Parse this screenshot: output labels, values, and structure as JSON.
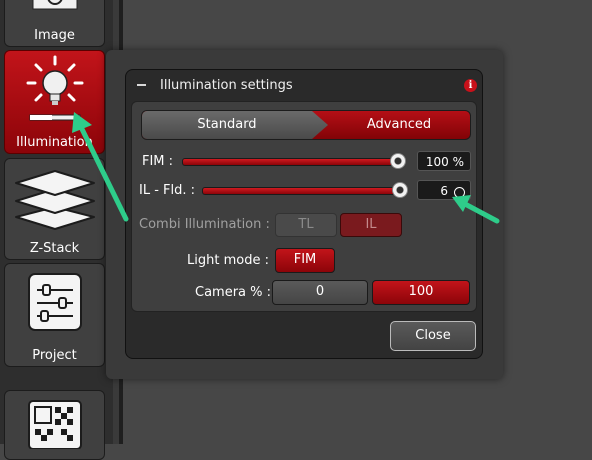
{
  "sidebar": {
    "items": [
      {
        "label": "Image",
        "icon": "image-icon",
        "active": false
      },
      {
        "label": "Illumination",
        "icon": "lamp-icon",
        "active": true
      },
      {
        "label": "Z-Stack",
        "icon": "layers-icon",
        "active": false
      },
      {
        "label": "Project",
        "icon": "sliders-icon",
        "active": false
      },
      {
        "label": "",
        "icon": "grid-icon",
        "active": false
      }
    ]
  },
  "dialog": {
    "title": "Illumination settings",
    "info_glyph": "i",
    "tabs": {
      "standard": "Standard",
      "advanced": "Advanced",
      "selected": "Advanced"
    },
    "fim": {
      "label": "FIM :",
      "value": "100 %",
      "level": 1.0
    },
    "il_fld": {
      "label": "IL - Fld. :",
      "value": "6",
      "level": 1.0
    },
    "combi": {
      "label": "Combi Illumination :",
      "tl": "TL",
      "il": "IL"
    },
    "light_mode": {
      "label": "Light mode :",
      "value": "FIM"
    },
    "camera": {
      "label": "Camera % :",
      "option_a": "0",
      "option_b": "100",
      "selected": "100"
    },
    "close_label": "Close"
  },
  "colors": {
    "accent_red": "#c2141a",
    "arrow_green": "#2ecc8a",
    "background": "#474747"
  }
}
